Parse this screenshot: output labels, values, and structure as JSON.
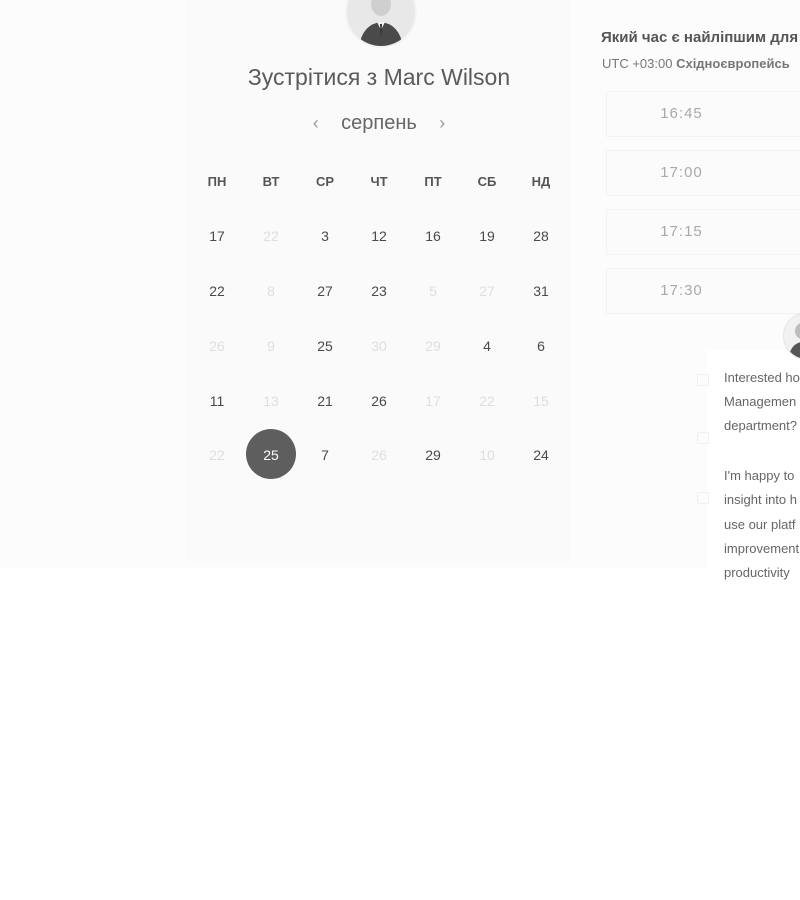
{
  "calendar": {
    "title": "Зустрітися з Marc Wilson",
    "month": "серпень",
    "prev_icon": "‹",
    "next_icon": "›",
    "weekdays": [
      "ПН",
      "ВТ",
      "СР",
      "ЧТ",
      "ПТ",
      "СБ",
      "НД"
    ],
    "weeks": [
      [
        {
          "d": "17",
          "dim": false
        },
        {
          "d": "22",
          "dim": true
        },
        {
          "d": "3",
          "dim": false
        },
        {
          "d": "12",
          "dim": false
        },
        {
          "d": "16",
          "dim": false
        },
        {
          "d": "19",
          "dim": false
        },
        {
          "d": "28",
          "dim": false
        }
      ],
      [
        {
          "d": "22",
          "dim": false
        },
        {
          "d": "8",
          "dim": true
        },
        {
          "d": "27",
          "dim": false
        },
        {
          "d": "23",
          "dim": false
        },
        {
          "d": "5",
          "dim": true
        },
        {
          "d": "27",
          "dim": true
        },
        {
          "d": "31",
          "dim": false
        }
      ],
      [
        {
          "d": "26",
          "dim": true
        },
        {
          "d": "9",
          "dim": true
        },
        {
          "d": "25",
          "dim": false
        },
        {
          "d": "30",
          "dim": true
        },
        {
          "d": "29",
          "dim": true
        },
        {
          "d": "4",
          "dim": false
        },
        {
          "d": "6",
          "dim": false
        }
      ],
      [
        {
          "d": "11",
          "dim": false
        },
        {
          "d": "13",
          "dim": true
        },
        {
          "d": "21",
          "dim": false
        },
        {
          "d": "26",
          "dim": false
        },
        {
          "d": "17",
          "dim": true
        },
        {
          "d": "22",
          "dim": true
        },
        {
          "d": "15",
          "dim": true
        }
      ],
      [
        {
          "d": "22",
          "dim": true
        },
        {
          "d": "25",
          "dim": false,
          "selected": true
        },
        {
          "d": "7",
          "dim": false
        },
        {
          "d": "26",
          "dim": true
        },
        {
          "d": "29",
          "dim": false
        },
        {
          "d": "10",
          "dim": true
        },
        {
          "d": "24",
          "dim": false
        }
      ]
    ]
  },
  "times": {
    "question": "Який час є найліпшим для",
    "timezone_offset": "UTC +03:00",
    "timezone_name": "Східноєвропейсь",
    "slots": [
      "16:45",
      "17:00",
      "17:15",
      "17:30"
    ]
  },
  "chat": {
    "lines": [
      "Interested ho",
      "Managemen",
      "department?",
      "",
      "I'm happy to",
      "insight into h",
      "use our platf",
      "improvement",
      "productivity"
    ]
  },
  "colors": {
    "selected_day": "#5e5e5e",
    "card_background": "#fafafa",
    "dim_day": "#dedede"
  }
}
